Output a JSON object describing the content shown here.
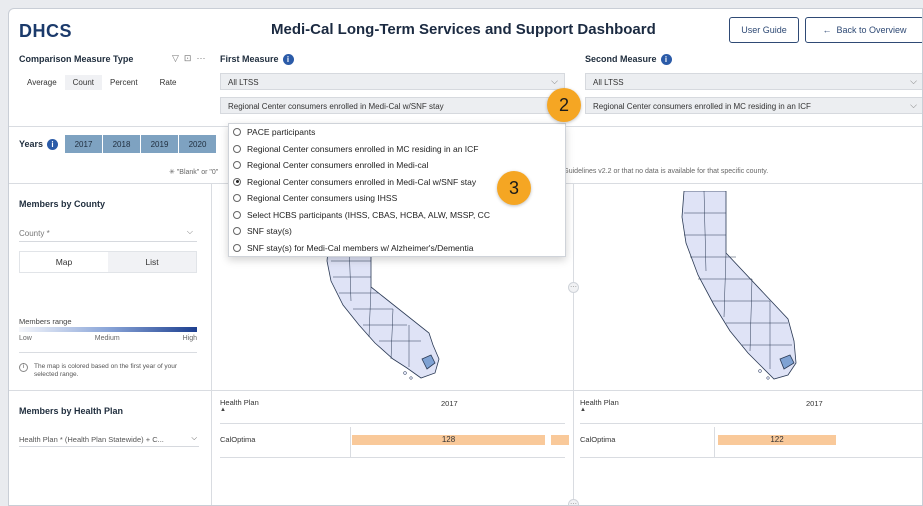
{
  "header": {
    "logo": "DHCS",
    "title": "Medi-Cal Long-Term Services and Support Dashboard",
    "user_guide": "User Guide",
    "back": "Back to Overview",
    "back_arrow": "←"
  },
  "comparison": {
    "title": "Comparison Measure Type",
    "tabs": [
      "Average",
      "Count",
      "Percent",
      "Rate"
    ],
    "active": "Count"
  },
  "first_measure": {
    "title": "First Measure",
    "category": "All LTSS",
    "selected": "Regional Center consumers enrolled in Medi-Cal w/SNF stay"
  },
  "second_measure": {
    "title": "Second Measure",
    "category": "All LTSS",
    "selected": "Regional Center consumers enrolled in MC residing in an ICF"
  },
  "dropdown": {
    "options": [
      {
        "label": "PACE participants",
        "selected": false
      },
      {
        "label": "Regional Center consumers enrolled in MC residing in an ICF",
        "selected": false
      },
      {
        "label": "Regional Center consumers enrolled in Medi-cal",
        "selected": false
      },
      {
        "label": "Regional Center consumers enrolled in Medi-Cal w/SNF stay",
        "selected": true
      },
      {
        "label": "Regional Center consumers using IHSS",
        "selected": false
      },
      {
        "label": "Select HCBS participants (IHSS, CBAS, HCBA, ALW, MSSP, CC",
        "selected": false
      },
      {
        "label": "SNF stay(s)",
        "selected": false
      },
      {
        "label": "SNF stay(s) for Medi-Cal members w/ Alzheimer's/Dementia",
        "selected": false
      }
    ]
  },
  "badges": {
    "step2": "2",
    "step3": "3"
  },
  "years": {
    "label": "Years",
    "items": [
      "2017",
      "2018",
      "2019",
      "2020"
    ]
  },
  "note": {
    "left": "✳ \"Blank\" or \"0\"",
    "right": "ion Guidelines v2.2 or that no data is available for that specific county."
  },
  "sidebar": {
    "members_by_county": "Members by County",
    "county_placeholder": "County *",
    "view_toggle": [
      "Map",
      "List"
    ],
    "members_range": "Members range",
    "range_labels": [
      "Low",
      "Medium",
      "High"
    ],
    "map_note": "The map is colored based on the first year of your selected range.",
    "members_by_health_plan": "Members by Health Plan",
    "health_plan_select": "Health Plan * (Health Plan Statewide) + C..."
  },
  "tables": {
    "left": {
      "col1": "Health Plan",
      "col2": "2017",
      "row_name": "CalOptima",
      "value": "128"
    },
    "right": {
      "col1": "Health Plan",
      "col2": "2017",
      "row_name": "CalOptima",
      "value": "122"
    }
  },
  "colors": {
    "map_fill": "#dfe3f6",
    "map_stroke": "#2b3a55",
    "highlight_county": "#7fa2d3",
    "bar": "#f9c99a",
    "year_btn": "#7ea2c1",
    "badge": "#f5a623"
  }
}
